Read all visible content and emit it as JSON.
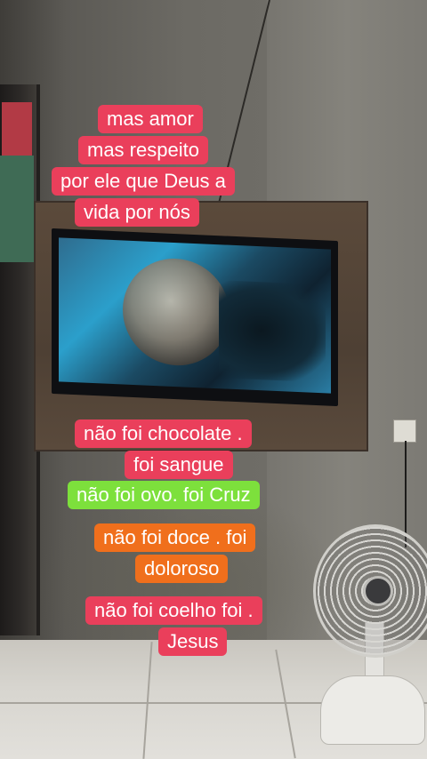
{
  "captions": {
    "block1": [
      "mas amor",
      "mas respeito",
      "por ele que Deus a",
      "vida por nós"
    ],
    "block2": [
      "não foi chocolate   .",
      "foi sangue"
    ],
    "green": "não foi ovo. foi Cruz",
    "orange": [
      "não foi doce . foi",
      "doloroso"
    ],
    "block3": [
      "não foi coelho foi .",
      "Jesus"
    ]
  },
  "colors": {
    "red_caption": "#ea3f5b",
    "green_caption": "#7de03c",
    "orange_caption": "#f06f1c",
    "text": "#ffffff"
  }
}
